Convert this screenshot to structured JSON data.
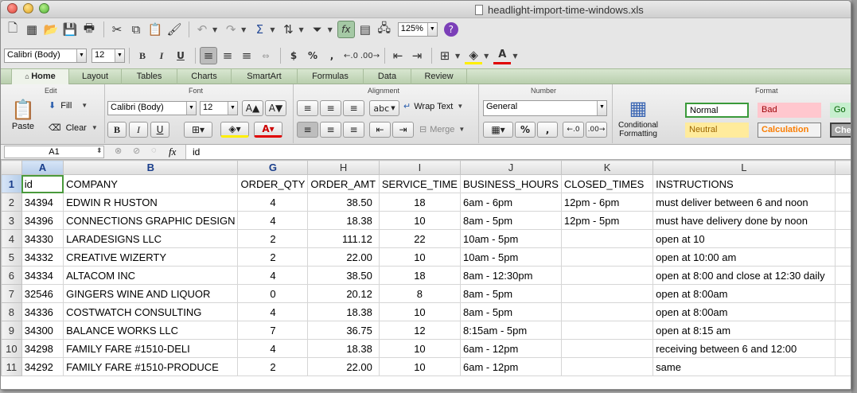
{
  "window": {
    "title": "headlight-import-time-windows.xls"
  },
  "toolbar": {
    "zoom": "125%",
    "font_name": "Calibri (Body)",
    "font_size": "12",
    "buttons": {
      "bold": "B",
      "italic": "I",
      "underline": "U",
      "currency": "$",
      "percent": "%",
      "comma": ","
    }
  },
  "ribbon_tabs": [
    "Home",
    "Layout",
    "Tables",
    "Charts",
    "SmartArt",
    "Formulas",
    "Data",
    "Review"
  ],
  "ribbon": {
    "groups": {
      "edit": "Edit",
      "font": "Font",
      "alignment": "Alignment",
      "number": "Number",
      "format": "Format"
    },
    "edit": {
      "paste": "Paste",
      "fill": "Fill",
      "clear": "Clear"
    },
    "font": {
      "name": "Calibri (Body)",
      "size": "12"
    },
    "alignment": {
      "abc": "abc",
      "wrap": "Wrap Text",
      "merge": "Merge"
    },
    "number": {
      "format": "General"
    },
    "format": {
      "conditional_line1": "Conditional",
      "conditional_line2": "Formatting",
      "styles": [
        "Normal",
        "Bad",
        "Go",
        "Neutral",
        "Calculation",
        "Che"
      ]
    }
  },
  "formula_bar": {
    "cell_ref": "A1",
    "fx": "fx",
    "content": "id"
  },
  "colors": {
    "ribbon_tab": "#c5d7bb",
    "selected_cell": "#4a9a3c",
    "header_selected": "#1a3e8b"
  },
  "sheet": {
    "column_letters": [
      "A",
      "B",
      "G",
      "H",
      "I",
      "J",
      "K",
      "L"
    ],
    "rows": [
      {
        "n": "1",
        "cells": [
          "id",
          "COMPANY",
          "ORDER_QTY",
          "ORDER_AMT",
          "SERVICE_TIME",
          "BUSINESS_HOURS",
          "CLOSED_TIMES",
          "INSTRUCTIONS"
        ]
      },
      {
        "n": "2",
        "cells": [
          "34394",
          "EDWIN R HUSTON",
          "4",
          "38.50",
          "18",
          "6am - 6pm",
          "12pm - 6pm",
          "must deliver between 6 and noon"
        ]
      },
      {
        "n": "3",
        "cells": [
          "34396",
          "CONNECTIONS GRAPHIC DESIGN",
          "4",
          "18.38",
          "10",
          "8am - 5pm",
          "12pm - 5pm",
          "must have delivery done by noon"
        ]
      },
      {
        "n": "4",
        "cells": [
          "34330",
          "LARADESIGNS LLC",
          "2",
          "111.12",
          "22",
          "10am - 5pm",
          "",
          "open at 10"
        ]
      },
      {
        "n": "5",
        "cells": [
          "34332",
          "CREATIVE WIZERTY",
          "2",
          "22.00",
          "10",
          "10am - 5pm",
          "",
          "open at 10:00 am"
        ]
      },
      {
        "n": "6",
        "cells": [
          "34334",
          "ALTACOM INC",
          "4",
          "38.50",
          "18",
          "8am - 12:30pm",
          "",
          "open at 8:00 and close at 12:30 daily"
        ]
      },
      {
        "n": "7",
        "cells": [
          "32546",
          "GINGERS WINE AND LIQUOR",
          "0",
          "20.12",
          "8",
          "8am - 5pm",
          "",
          "open at 8:00am"
        ]
      },
      {
        "n": "8",
        "cells": [
          "34336",
          "COSTWATCH CONSULTING",
          "4",
          "18.38",
          "10",
          "8am - 5pm",
          "",
          "open at 8:00am"
        ]
      },
      {
        "n": "9",
        "cells": [
          "34300",
          "BALANCE WORKS LLC",
          "7",
          "36.75",
          "12",
          "8:15am - 5pm",
          "",
          "open at 8:15 am"
        ]
      },
      {
        "n": "10",
        "cells": [
          "34298",
          "FAMILY FARE #1510-DELI",
          "4",
          "18.38",
          "10",
          "6am - 12pm",
          "",
          "receiving between 6 and 12:00"
        ]
      },
      {
        "n": "11",
        "cells": [
          "34292",
          "FAMILY FARE #1510-PRODUCE",
          "2",
          "22.00",
          "10",
          "6am - 12pm",
          "",
          "same"
        ]
      }
    ]
  }
}
